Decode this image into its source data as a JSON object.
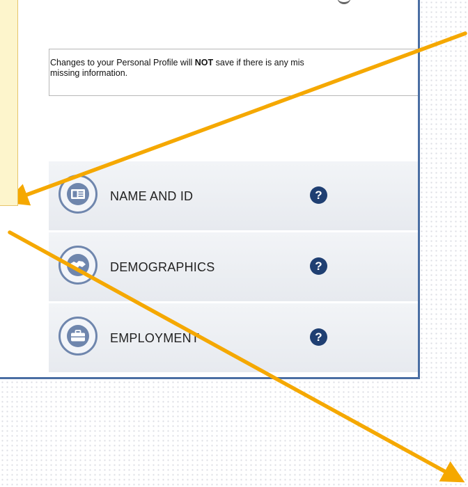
{
  "notice": {
    "prefix": "Changes to your Personal Profile will ",
    "emphasis": "NOT",
    "suffix": " save if there is any mis",
    "line2": "missing information."
  },
  "sections": [
    {
      "label": "NAME AND ID",
      "help": "?",
      "icon": "id-card-icon"
    },
    {
      "label": "DEMOGRAPHICS",
      "help": "?",
      "icon": "globe-icon"
    },
    {
      "label": "EMPLOYMENT",
      "help": "?",
      "icon": "briefcase-icon"
    }
  ],
  "colors": {
    "arrow": "#f5a800",
    "window_border": "#4a6ea3",
    "help_badge": "#1f3f72",
    "icon_ring": "#6f86ad",
    "side_panel": "#fdf5cc"
  }
}
